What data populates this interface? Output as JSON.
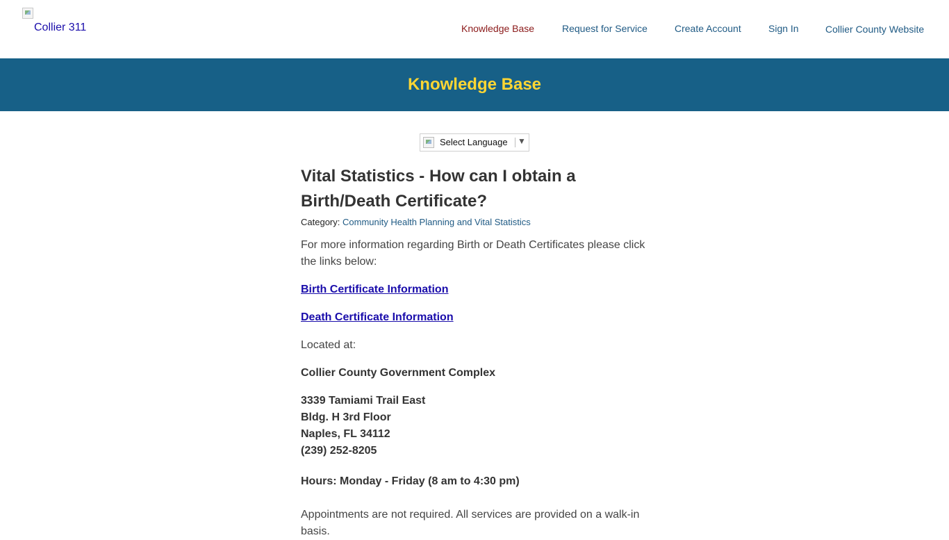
{
  "header": {
    "logo_alt": "Collier 311",
    "nav": [
      {
        "label": "Knowledge Base",
        "active": true
      },
      {
        "label": "Request for Service",
        "active": false
      },
      {
        "label": "Create Account",
        "active": false
      },
      {
        "label": "Sign In",
        "active": false
      },
      {
        "label": "Collier County Website",
        "active": false
      }
    ]
  },
  "banner": {
    "title": "Knowledge Base"
  },
  "language": {
    "label": "Select Language",
    "arrow": "▼"
  },
  "article": {
    "title_line1": "Vital Statistics - How can I obtain a",
    "title_line2": "Birth/Death Certificate?",
    "category_label": "Category:",
    "category_value": "Community Health Planning and Vital Statistics",
    "intro": "For more information regarding Birth or Death Certificates please click the links below:",
    "links": [
      "Birth Certificate Information",
      "Death Certificate Information"
    ],
    "located_at": "Located at:",
    "location_name": "Collier County Government Complex",
    "address": [
      "3339 Tamiami Trail East",
      "Bldg. H 3rd Floor",
      "Naples, FL 34112",
      "(239) 252-8205"
    ],
    "hours": "Hours: Monday - Friday (8 am to 4:30 pm)",
    "appointments": "Appointments are not required. All services are provided on a walk-in basis."
  },
  "colors": {
    "banner": "#176087",
    "banner_title": "#ffd633",
    "nav_link": "#1f5a84",
    "nav_active": "#8b1a1a",
    "link": "#1a0dab"
  }
}
